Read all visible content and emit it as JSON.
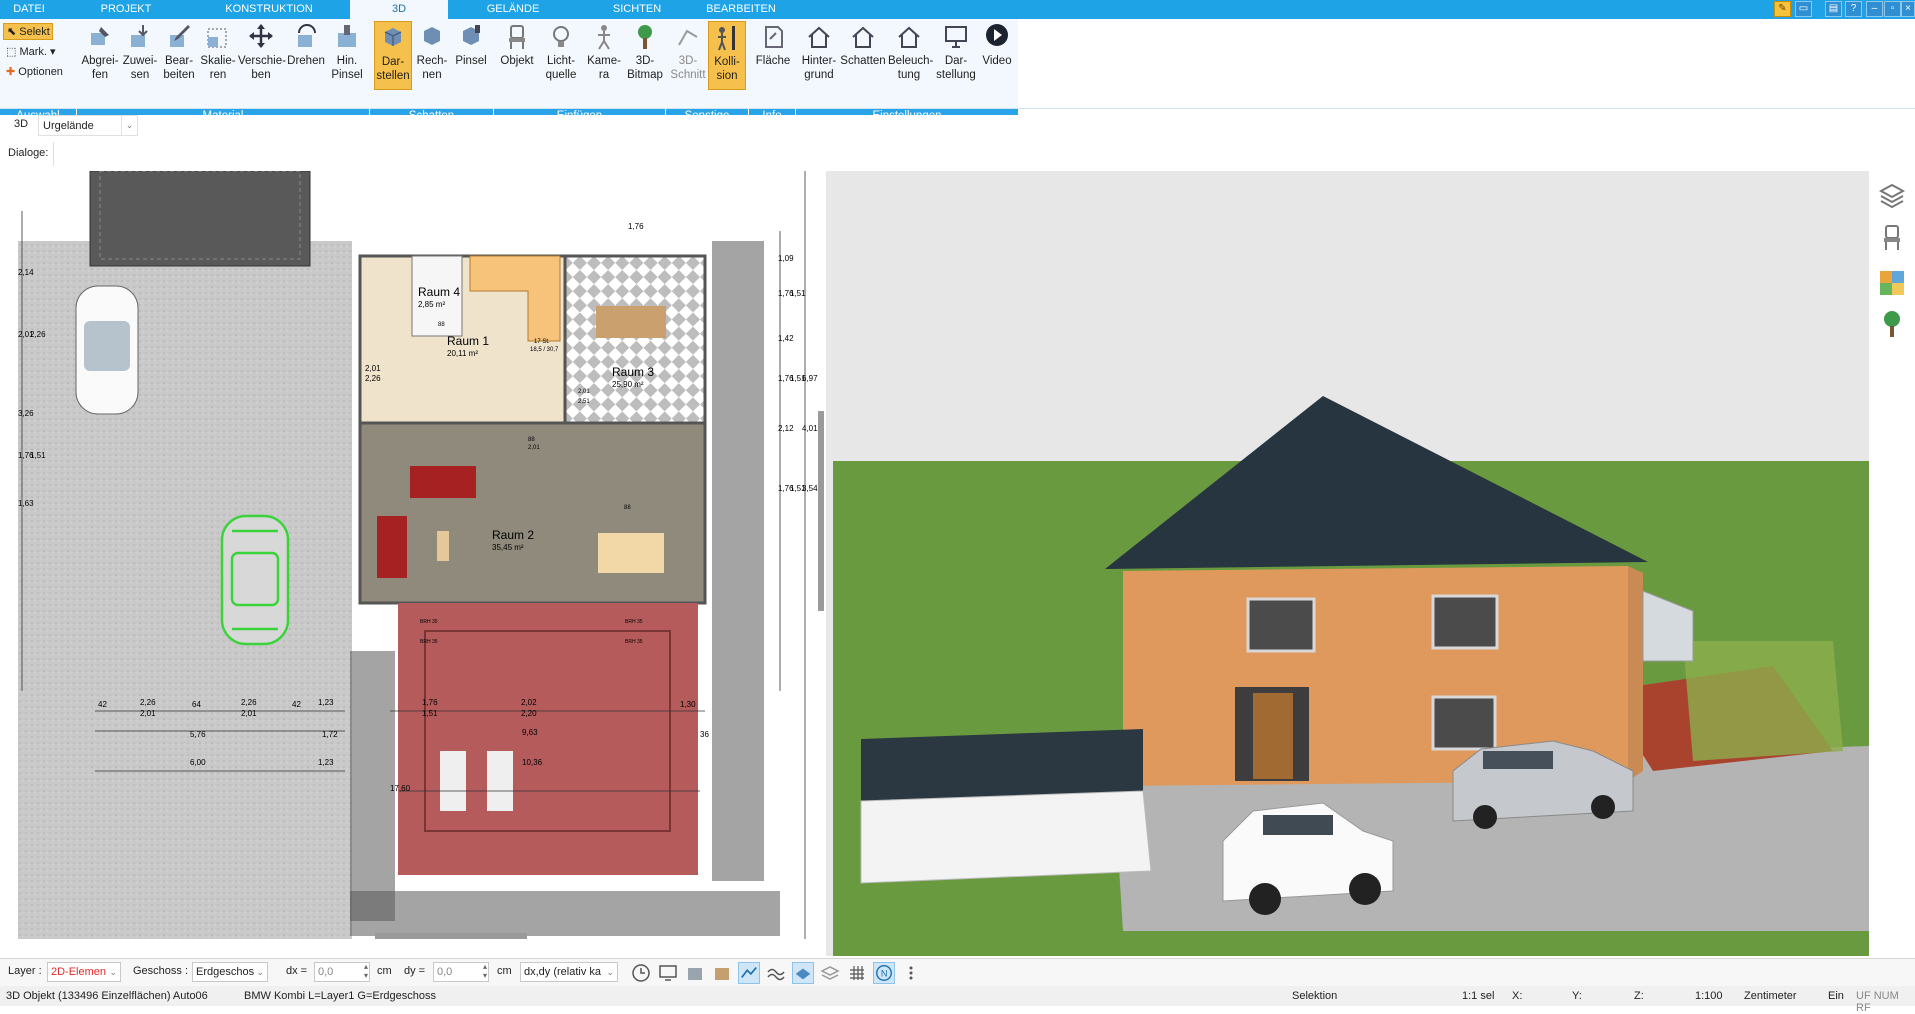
{
  "tabs": [
    "DATEI",
    "PROJEKT",
    "KONSTRUKTION",
    "3D",
    "GELÄNDE",
    "SICHTEN",
    "BEARBEITEN"
  ],
  "ribbon": {
    "selection": {
      "select": "Selekt",
      "mark": "Mark.",
      "options": "Optionen"
    },
    "buttons": [
      "Abgrei-\nfen",
      "Zuwei-\nsen",
      "Bear-\nbeiten",
      "Skalie-\nren",
      "Verschie-\nben",
      "Drehen",
      "Hin.\nPinsel",
      "Dar-\nstellen",
      "Rech-\nnen",
      "Pinsel",
      "Objekt",
      "Licht-\nquelle",
      "Kame-\nra",
      "3D-\nBitmap",
      "3D-\nSchnitt",
      "Kolli-\nsion",
      "Fläche",
      "Hinter-\ngrund",
      "Schatten",
      "Beleuch-\ntung",
      "Dar-\nstellung",
      "Video"
    ],
    "groups": [
      "Auswahl",
      "Material",
      "Schatten",
      "Einfügen",
      "Sonstige",
      "Info",
      "Einstellungen"
    ]
  },
  "bar3d": {
    "mode": "3D",
    "terrain": "Urgelände"
  },
  "dialogs_label": "Dialoge:",
  "plan": {
    "rooms": [
      {
        "name": "Raum 4",
        "area": "2,85 m²"
      },
      {
        "name": "Raum 1",
        "area": "20,11 m²"
      },
      {
        "name": "Raum 3",
        "area": "25,90 m²"
      },
      {
        "name": "Raum 2",
        "area": "35,45 m²"
      }
    ],
    "dims": {
      "d_top": "1,76",
      "d_left": [
        "2,14",
        "2,01",
        "2,26",
        "3,26",
        "1,76",
        "1,51",
        "1,63"
      ],
      "d_right": [
        "1,09",
        "1,51",
        "1,76",
        "1,42",
        "1,76",
        "1,51",
        "2,12",
        "1,76",
        "1,51",
        "3,54",
        "6,97",
        "4,01"
      ],
      "d_bottom": [
        "42",
        "2,26",
        "2,01",
        "64",
        "2,26",
        "2,01",
        "42",
        "1,23",
        "1,76",
        "1,51",
        "2,02",
        "2,20",
        "1,30",
        "5,76",
        "1,72",
        "6,00",
        "1,23",
        "9,63",
        "10,36",
        "17,60",
        "36"
      ],
      "door": [
        "2,01",
        "2,26"
      ],
      "misc": [
        "BRH 35",
        "BRH 35",
        "BRH 35",
        "BRH 35",
        "88",
        "2,01",
        "88",
        "2,01",
        "2,51",
        "88",
        "17 St.",
        "18,5 / 30,7"
      ]
    }
  },
  "bottombar": {
    "layer_label": "Layer :",
    "layer_value": "2D-Elemen",
    "floor_label": "Geschoss :",
    "floor_value": "Erdgeschos",
    "dx_label": "dx =",
    "dx_value": "0,0",
    "dx_unit": "cm",
    "dy_label": "dy =",
    "dy_value": "0,0",
    "dy_unit": "cm",
    "mode_value": "dx,dy (relativ ka"
  },
  "statusbar": {
    "object": "3D Objekt (133496 Einzelflächen) Auto06",
    "info": "BMW Kombi L=Layer1 G=Erdgeschoss",
    "selection": "Selektion",
    "count": "1:1 sel",
    "x": "X:",
    "y": "Y:",
    "z": "Z:",
    "scale": "1:100",
    "unit": "Zentimeter",
    "ein": "Ein",
    "flags": "UF  NUM  RF"
  },
  "colors": {
    "tabbar": "#1ea3e6",
    "ribbon_bg": "#f2f8fd",
    "group_bar": "#2aa4e8",
    "active_button": "#f5c04b",
    "selection_green": "#3ad43a",
    "house_wall": "#e0995c",
    "roof": "#26353f",
    "grass": "#6a9a3f"
  }
}
